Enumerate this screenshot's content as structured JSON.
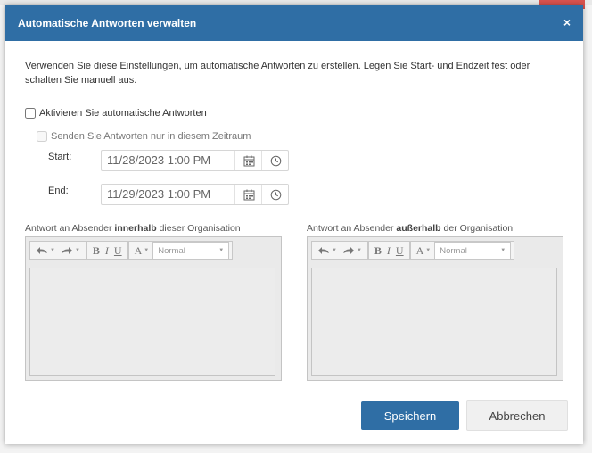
{
  "dialog": {
    "title": "Automatische Antworten verwalten",
    "close_symbol": "×",
    "description": "Verwenden Sie diese Einstellungen, um automatische Antworten zu erstellen. Legen Sie Start- und Endzeit fest oder schalten Sie manuell aus."
  },
  "options": {
    "enable_label": "Aktivieren Sie automatische Antworten",
    "timerange_label": "Senden Sie Antworten nur in diesem Zeitraum"
  },
  "schedule": {
    "start_label": "Start:",
    "start_value": "11/28/2023 1:00 PM",
    "end_label": "End:",
    "end_value": "11/29/2023 1:00 PM"
  },
  "editors": {
    "inside": {
      "label_pre": "Antwort an Absender ",
      "label_bold": "innerhalb",
      "label_post": " dieser Organisation"
    },
    "outside": {
      "label_pre": "Antwort an Absender ",
      "label_bold": "außerhalb",
      "label_post": " der Organisation"
    },
    "toolbar": {
      "bold": "B",
      "italic": "I",
      "underline": "U",
      "font_color": "A",
      "format_value": "Normal"
    }
  },
  "buttons": {
    "save": "Speichern",
    "cancel": "Abbrechen"
  },
  "icons": [
    "undo-icon",
    "redo-icon",
    "calendar-icon",
    "clock-icon",
    "dropdown-arrow-icon"
  ],
  "colors": {
    "accent": "#2f6ea5",
    "title_text": "#ffffff"
  }
}
